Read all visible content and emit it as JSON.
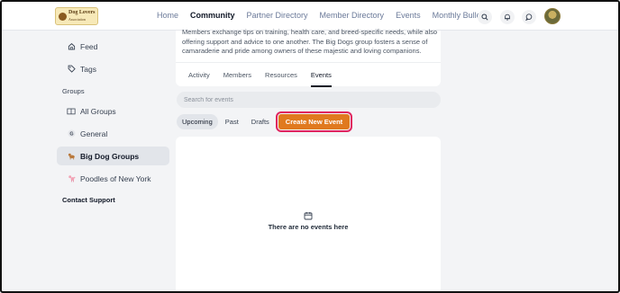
{
  "header": {
    "logo_text": "Dog Lovers",
    "logo_sub": "Association",
    "nav": [
      {
        "label": "Home",
        "active": false
      },
      {
        "label": "Community",
        "active": true
      },
      {
        "label": "Partner Directory",
        "active": false
      },
      {
        "label": "Member Directory",
        "active": false
      },
      {
        "label": "Events",
        "active": false
      },
      {
        "label": "Monthly Bulletin",
        "active": false
      }
    ],
    "icons": [
      "search-icon",
      "bell-icon",
      "chat-icon"
    ]
  },
  "sidebar": {
    "items_top": [
      {
        "label": "Feed",
        "icon": "home-icon"
      },
      {
        "label": "Tags",
        "icon": "tag-icon"
      }
    ],
    "groups_heading": "Groups",
    "groups": [
      {
        "label": "All Groups",
        "icon": "book-icon",
        "active": false
      },
      {
        "label": "General",
        "icon": "g-badge-icon",
        "active": false
      },
      {
        "label": "Big Dog Groups",
        "icon": "dog-emoji-icon",
        "active": true
      },
      {
        "label": "Poodles of New York",
        "icon": "poodle-emoji-icon",
        "active": false
      }
    ],
    "contact_support": "Contact Support"
  },
  "group": {
    "description": "Members exchange tips on training, health care, and breed-specific needs, while also offering support and advice to one another. The Big Dogs group fosters a sense of camaraderie and pride among owners of these majestic and loving companions.",
    "tabs": [
      {
        "label": "Activity",
        "active": false
      },
      {
        "label": "Members",
        "active": false
      },
      {
        "label": "Resources",
        "active": false
      },
      {
        "label": "Events",
        "active": true
      }
    ]
  },
  "events": {
    "search_placeholder": "Search for events",
    "filters": [
      {
        "label": "Upcoming",
        "active": true
      },
      {
        "label": "Past",
        "active": false
      },
      {
        "label": "Drafts",
        "active": false
      }
    ],
    "create_label": "Create New Event",
    "empty_text": "There are no events here"
  },
  "colors": {
    "accent": "#e07a1f",
    "highlight_border": "#e0245e"
  }
}
